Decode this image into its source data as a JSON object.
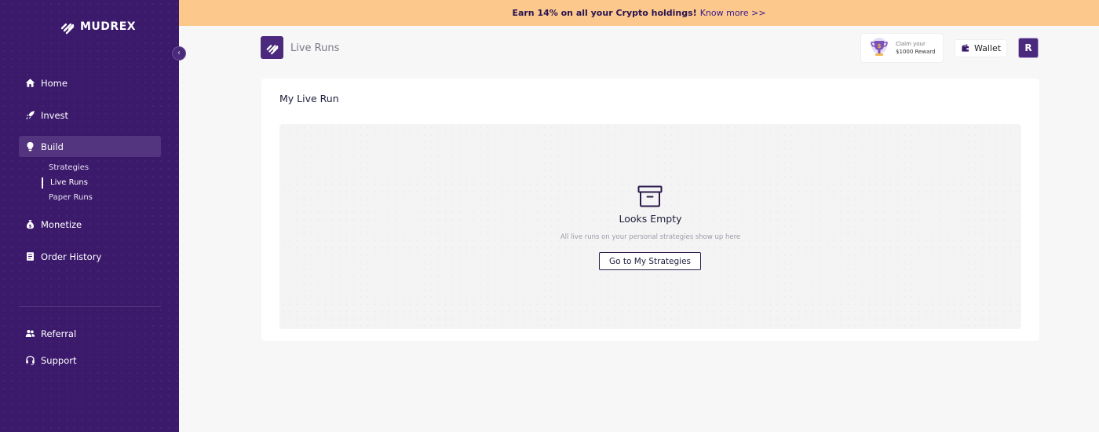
{
  "brand": {
    "name": "MUDREX"
  },
  "banner": {
    "text": "Earn 14% on all your Crypto holdings!",
    "link": "Know more >>"
  },
  "sidebar": {
    "items": [
      {
        "label": "Home",
        "icon": "home-icon"
      },
      {
        "label": "Invest",
        "icon": "rocket-icon"
      },
      {
        "label": "Build",
        "icon": "lightbulb-icon"
      },
      {
        "label": "Monetize",
        "icon": "money-bag-icon"
      },
      {
        "label": "Order History",
        "icon": "document-icon"
      }
    ],
    "build_subitems": [
      "Strategies",
      "Live Runs",
      "Paper Runs"
    ],
    "active_item": "Build",
    "active_subitem": "Live Runs",
    "bottom_items": [
      {
        "label": "Referral",
        "icon": "people-icon"
      },
      {
        "label": "Support",
        "icon": "headset-icon"
      }
    ]
  },
  "header": {
    "page_title": "Live Runs",
    "reward": {
      "line1": "Claim your",
      "line2": "$1000 Reward"
    },
    "wallet_label": "Wallet",
    "avatar_initial": "R"
  },
  "card": {
    "title": "My Live Run",
    "empty": {
      "title": "Looks Empty",
      "description": "All live runs on your personal strategies show up here",
      "button_label": "Go to My Strategies"
    }
  },
  "colors": {
    "sidebar_bg": "#3b1a6b",
    "active_item_bg": "#52357e",
    "banner_bg": "#fcc88c",
    "accent": "#4b2a7e"
  }
}
